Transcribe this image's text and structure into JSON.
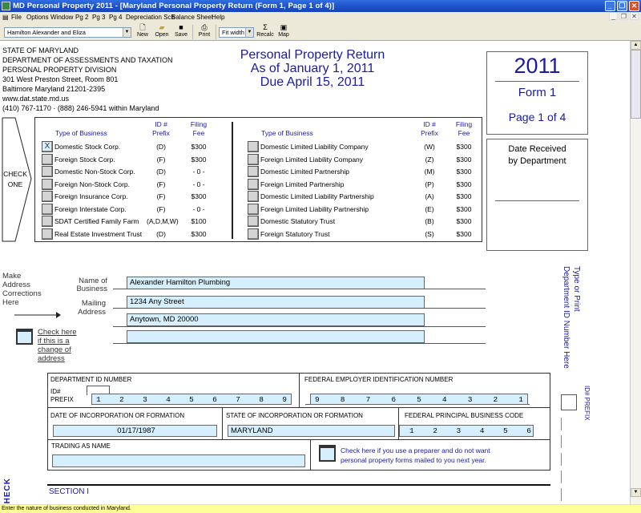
{
  "window": {
    "title": "MD Personal Property 2011 - [Maryland Personal Property Return (Form 1, Page 1 of 4)]",
    "controls": {
      "minimize": "_",
      "restore": "❐",
      "close": "✕"
    }
  },
  "menu": [
    "File",
    "Options",
    "Window",
    "Pg 2",
    "Pg 3",
    "Pg 4",
    "Depreciation Sch",
    "Balance Sheet",
    "Help"
  ],
  "toolbar": {
    "client_select": "Hamilton Alexander and Eliza",
    "new_label": "New",
    "open_label": "Open",
    "save_label": "Save",
    "print_label": "Print",
    "zoom_select": "Fit width",
    "recalc_label": "Recalc",
    "map_label": "Map"
  },
  "agency": {
    "lines": [
      "STATE OF MARYLAND",
      "DEPARTMENT OF ASSESSMENTS AND TAXATION",
      "PERSONAL PROPERTY DIVISION",
      "301 West Preston Street, Room 801",
      "Baltimore Maryland 21201-2395",
      "www.dat.state.md.us",
      "(410) 767-1170 · (888) 246-5941 within Maryland"
    ]
  },
  "form_title": {
    "line1": "Personal Property Return",
    "line2": "As of January 1, 2011",
    "line3": "Due April 15, 2011"
  },
  "form_box": {
    "year": "2011",
    "form": "Form 1",
    "page": "Page 1 of 4"
  },
  "date_received": {
    "line1": "Date Received",
    "line2": "by Department"
  },
  "check_one": {
    "line1": "CHECK",
    "line2": "ONE"
  },
  "business_types": {
    "headers": {
      "type": "Type of Business",
      "prefix1": "ID #",
      "prefix2": "Prefix",
      "fee1": "Filing",
      "fee2": "Fee"
    },
    "left": [
      {
        "checked": "X",
        "name": "Domestic Stock Corp.",
        "prefix": "(D)",
        "fee": "$300"
      },
      {
        "checked": "",
        "name": "Foreign Stock Corp.",
        "prefix": "(F)",
        "fee": "$300"
      },
      {
        "checked": "",
        "name": "Domestic Non-Stock Corp.",
        "prefix": "(D)",
        "fee": "- 0 -"
      },
      {
        "checked": "",
        "name": "Foreign Non-Stock Corp.",
        "prefix": "(F)",
        "fee": "- 0 -"
      },
      {
        "checked": "",
        "name": "Foreign Insurance Corp.",
        "prefix": "(F)",
        "fee": "$300"
      },
      {
        "checked": "",
        "name": "Foreign Interstate Corp.",
        "prefix": "(F)",
        "fee": "- 0 -"
      },
      {
        "checked": "",
        "name": "SDAT Certified Family  Farm",
        "prefix": "(A,D,M,W)",
        "fee": "$100"
      },
      {
        "checked": "",
        "name": "Real Estate Investment Trust",
        "prefix": "(D)",
        "fee": "$300"
      }
    ],
    "right": [
      {
        "checked": "",
        "name": "Domestic Limited Liability Company",
        "prefix": "(W)",
        "fee": "$300"
      },
      {
        "checked": "",
        "name": "Foreign Limited Liability Company",
        "prefix": "(Z)",
        "fee": "$300"
      },
      {
        "checked": "",
        "name": "Domestic Limited Partnership",
        "prefix": "(M)",
        "fee": "$300"
      },
      {
        "checked": "",
        "name": "Foreign Limited Partnership",
        "prefix": "(P)",
        "fee": "$300"
      },
      {
        "checked": "",
        "name": "Domestic Limited Liability Partnership",
        "prefix": "(A)",
        "fee": "$300"
      },
      {
        "checked": "",
        "name": "Foreign Limited Liability Partnership",
        "prefix": "(E)",
        "fee": "$300"
      },
      {
        "checked": "",
        "name": "Domestic Statutory Trust",
        "prefix": "(B)",
        "fee": "$300"
      },
      {
        "checked": "",
        "name": "Foreign Statutory Trust",
        "prefix": "(S)",
        "fee": "$300"
      }
    ]
  },
  "address": {
    "corrections_note": [
      "Make",
      "Address",
      "Corrections",
      "Here"
    ],
    "name_label": [
      "Name of",
      "Business"
    ],
    "mailing_label": [
      "Mailing",
      "Address"
    ],
    "business_name": "Alexander Hamilton Plumbing",
    "address_line1": "1234 Any Street",
    "address_line2": "Anytown, MD 20000",
    "address_line3": "",
    "change_check": [
      "Check here",
      "if this is a",
      "change of",
      "address"
    ],
    "side_note_1": "Type or Print",
    "side_note_2": "Department ID Number Here"
  },
  "ids": {
    "dept_id_label": "DEPARTMENT ID NUMBER",
    "id_prefix_label": [
      "ID#",
      "PREFIX"
    ],
    "dept_id_digits": [
      "1",
      "2",
      "3",
      "4",
      "5",
      "6",
      "7",
      "8",
      "9"
    ],
    "fein_label": "FEDERAL EMPLOYER IDENTIFICATION NUMBER",
    "fein_digits": [
      "9",
      "8",
      "7",
      "6",
      "5",
      "4",
      "3",
      "2",
      "1"
    ],
    "date_inc_label": "DATE OF INCORPORATION OR FORMATION",
    "date_inc_value": "01/17/1987",
    "state_inc_label": "STATE OF INCORPORATION OR FORMATION",
    "state_inc_value": "MARYLAND",
    "pbc_label": "FEDERAL PRINCIPAL BUSINESS CODE",
    "pbc_digits": [
      "1",
      "2",
      "3",
      "4",
      "5",
      "6"
    ],
    "trading_label": "TRADING AS NAME",
    "trading_value": "",
    "preparer_check": [
      "Check here if you use a preparer and do not want",
      "personal property forms mailed to you next year."
    ],
    "side_id_prefix": "ID# PREFIX"
  },
  "section": {
    "title": "SECTION I",
    "side_check": "HECK"
  },
  "status_bar": "Enter the nature of business conducted in Maryland."
}
